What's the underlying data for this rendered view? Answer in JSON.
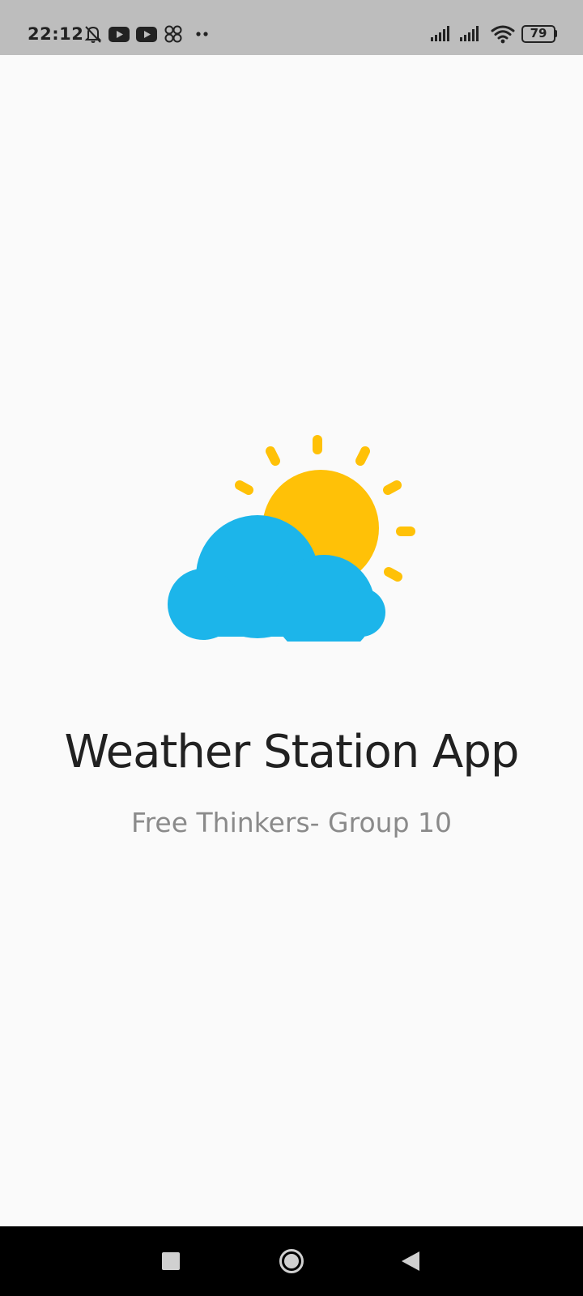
{
  "status_bar": {
    "time": "22:12",
    "battery_level": "79",
    "icons": [
      "muted-bell-icon",
      "youtube-icon",
      "youtube-icon",
      "app-notification-icon",
      "more-dots-icon",
      "signal-icon",
      "signal-icon",
      "wifi-icon",
      "battery-icon"
    ]
  },
  "splash": {
    "logo_icon": "partly-cloudy-icon",
    "title": "Weather Station App",
    "subtitle": "Free Thinkers- Group 10"
  },
  "navigation_bar": {
    "buttons": [
      "recents-button",
      "home-button",
      "back-button"
    ]
  },
  "colors": {
    "sun": "#FFC107",
    "cloud": "#1CB5EA",
    "status_bar_bg": "#BDBDBD",
    "background": "#FAFAFA",
    "title": "#212121",
    "subtitle": "#8A8A8A"
  }
}
